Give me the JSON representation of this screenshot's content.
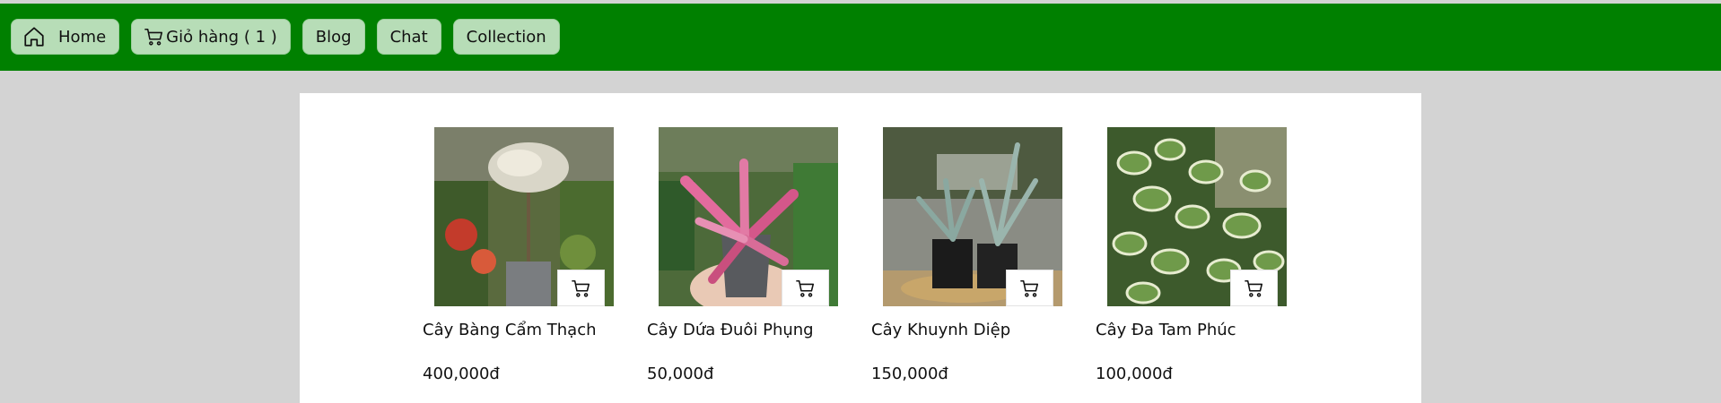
{
  "nav": {
    "home_label": "Home",
    "cart_label": "Giỏ hàng ( 1 )",
    "blog_label": "Blog",
    "chat_label": "Chat",
    "collection_label": "Collection"
  },
  "products": [
    {
      "name": "Cây Bàng Cẩm Thạch",
      "price": "400,000đ"
    },
    {
      "name": "Cây Dứa Đuôi Phụng",
      "price": "50,000đ"
    },
    {
      "name": "Cây Khuynh Diệp",
      "price": "150,000đ"
    },
    {
      "name": "Cây Đa Tam Phúc",
      "price": "100,000đ"
    }
  ],
  "colors": {
    "header_bg": "#008000",
    "nav_button_bg": "#b7ddb7",
    "page_bg": "#d3d3d3",
    "panel_bg": "#ffffff"
  },
  "icons": {
    "home": "home-icon",
    "cart": "cart-icon",
    "add_to_cart": "cart-icon"
  }
}
